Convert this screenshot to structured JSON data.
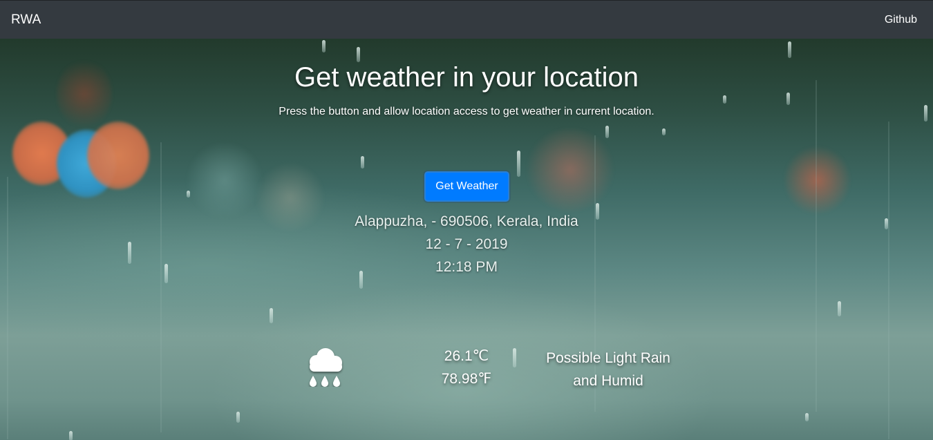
{
  "navbar": {
    "brand": "RWA",
    "link_label": "Github",
    "background": "#343a40"
  },
  "hero": {
    "title": "Get weather in your location",
    "subtitle": "Press the button and allow location access to get weather in current location.",
    "button_label": "Get Weather",
    "button_color": "#007bff"
  },
  "location": {
    "address": "Alappuzha, - 690506, Kerala, India",
    "date": "12 - 7 - 2019",
    "time": "12:18 PM"
  },
  "weather": {
    "icon": "cloud-rain-icon",
    "temp_c": "26.1℃",
    "temp_f": "78.98℉",
    "summary_line1": "Possible Light Rain",
    "summary_line2": "and Humid"
  }
}
